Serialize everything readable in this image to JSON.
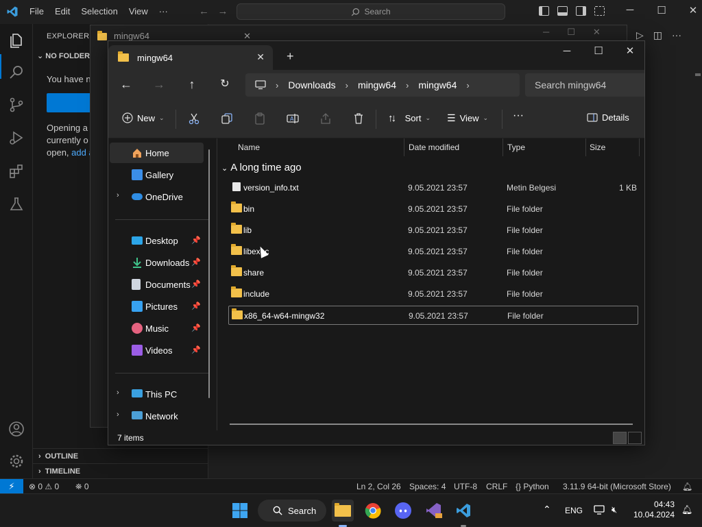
{
  "vscode": {
    "menus": [
      "File",
      "Edit",
      "Selection",
      "View",
      "···"
    ],
    "search_label": "Search",
    "sidebar": {
      "title": "EXPLORER",
      "no_folder": "NO FOLDER",
      "text1": "You have n",
      "text2_line1": "Opening a",
      "text2_line2": "currently o",
      "text2_line3": "open,",
      "text2_link": "add a",
      "outline": "OUTLINE",
      "timeline": "TIMELINE"
    },
    "statusbar": {
      "problems": "⊗ 0 ⚠ 0",
      "ports": "⛯ 0",
      "position": "Ln 2, Col 26",
      "spaces": "Spaces: 4",
      "encoding": "UTF-8",
      "eol": "CRLF",
      "language": "Python",
      "interpreter": "3.11.9 64-bit (Microsoft Store)"
    }
  },
  "explorer": {
    "tab_title": "mingw64",
    "breadcrumb": [
      "Downloads",
      "mingw64",
      "mingw64"
    ],
    "search_placeholder": "Search mingw64",
    "toolbar": {
      "new_label": "New",
      "sort_label": "Sort",
      "view_label": "View",
      "more_label": "···",
      "details_label": "Details"
    },
    "nav": {
      "home": "Home",
      "gallery": "Gallery",
      "onedrive": "OneDrive",
      "desktop": "Desktop",
      "downloads": "Downloads",
      "documents": "Documents",
      "pictures": "Pictures",
      "music": "Music",
      "videos": "Videos",
      "thispc": "This PC",
      "network": "Network"
    },
    "columns": {
      "name": "Name",
      "date": "Date modified",
      "type": "Type",
      "size": "Size"
    },
    "group_header": "A long time ago",
    "files": [
      {
        "name": "version_info.txt",
        "date": "9.05.2021 23:57",
        "type": "Metin Belgesi",
        "size": "1 KB",
        "kind": "file"
      },
      {
        "name": "bin",
        "date": "9.05.2021 23:57",
        "type": "File folder",
        "size": "",
        "kind": "folder"
      },
      {
        "name": "lib",
        "date": "9.05.2021 23:57",
        "type": "File folder",
        "size": "",
        "kind": "folder"
      },
      {
        "name": "libexec",
        "date": "9.05.2021 23:57",
        "type": "File folder",
        "size": "",
        "kind": "folder"
      },
      {
        "name": "share",
        "date": "9.05.2021 23:57",
        "type": "File folder",
        "size": "",
        "kind": "folder"
      },
      {
        "name": "include",
        "date": "9.05.2021 23:57",
        "type": "File folder",
        "size": "",
        "kind": "folder"
      },
      {
        "name": "x86_64-w64-mingw32",
        "date": "9.05.2021 23:57",
        "type": "File folder",
        "size": "",
        "kind": "folder"
      }
    ],
    "status_count": "7 items"
  },
  "taskbar": {
    "search_label": "Search",
    "lang": "ENG",
    "time": "04:43",
    "date": "10.04.2024"
  },
  "ghost": {
    "tab_title": "mingw64"
  },
  "colors": {
    "accent": "#0078d4",
    "folder": "#f2c04a"
  }
}
